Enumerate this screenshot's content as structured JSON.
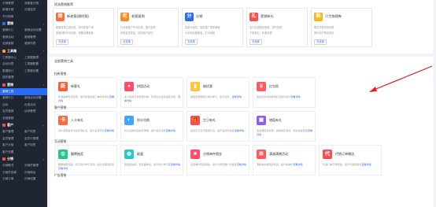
{
  "sidebar": {
    "groups": [
      {
        "id": "g0",
        "rows": [
          [
            "分销管理",
            "消费者分销"
          ],
          [
            "新增分销",
            "分销会员"
          ],
          [
            "开分销商",
            ""
          ]
        ]
      },
      {
        "id": "g1",
        "title": "营销",
        "rows": [
          [
            "营销中心",
            "营销活动设置"
          ],
          [
            "营销活动",
            "营销管理"
          ],
          [
            "全部营销",
            "营销列表"
          ]
        ]
      },
      {
        "id": "g2",
        "title": "工具箱",
        "rows": [
          [
            "工具箱中心",
            "工具箱管理"
          ],
          [
            "活动列表",
            "工具箱配置"
          ],
          [
            "数据统计",
            "工具箱设置"
          ],
          [
            "插件管理",
            ""
          ]
        ]
      },
      {
        "id": "g3",
        "title": "营销",
        "highlight": "营销工具",
        "rows": [
          [
            "营销中心",
            "营销活动设置"
          ],
          [
            "活动",
            "优惠活动"
          ],
          [
            "会员营销",
            "活动管理"
          ],
          [
            "全部营销",
            ""
          ]
        ]
      },
      {
        "id": "g4",
        "title": "客户",
        "rows": [
          [
            "客户管理",
            "客户列表"
          ],
          [
            "会员管理",
            "会员卡管理"
          ],
          [
            "客户分组",
            "客户标签"
          ],
          [
            "客户设置",
            ""
          ]
        ]
      },
      {
        "id": "g5",
        "title": "分销",
        "rows": [
          [
            "分销概况",
            "分销员管理"
          ],
          [
            "分销员招募",
            "分销商品"
          ],
          [
            "分销订单",
            "分销设置"
          ]
        ]
      }
    ]
  },
  "top_section": {
    "title": "优选营销推荐",
    "cards": [
      {
        "icon": "图",
        "color": "#ff6a3d",
        "name": "新老客(限时版)",
        "line1": "新客首单立减优惠，吸引新客下单",
        "line2": "老客回购专享优惠，唤醒沉睡老客",
        "btn": "去设置"
      },
      {
        "icon": "老",
        "color": "#ff8a1f",
        "name": "老客复购",
        "line1": "针对老客户专享优惠，提升复购",
        "line2": "享受会员权益，增加用户粘性",
        "btn": "去设置"
      },
      {
        "icon": "分",
        "color": "#2b6cf6",
        "name": "分销",
        "line1": "招募分销员，裂变推广带来新客",
        "line2": "分享商品赚佣金，扩大销量",
        "btn": "去设置"
      },
      {
        "icon": "礼",
        "color": "#ff4d4f",
        "name": "营销有礼",
        "line1": "支付后领取优惠券，提升复购",
        "line2": "下单有礼，刺激消费",
        "btn": "去设置"
      },
      {
        "icon": "购",
        "color": "#ffb31a",
        "name": "只生物理券",
        "line1": "购买享受折扣优惠",
        "line2": "提升用户购买转化",
        "btn": "去设置"
      }
    ]
  },
  "bottom_section": {
    "title": "全部营销工具",
    "categories": [
      {
        "name": "拉新营销",
        "tools": [
          {
            "icon": "新",
            "color": "#ff5c35",
            "name": "新客礼",
            "desc": "新客首单专享优惠，吸引新客快速下单转化成交",
            "link": "查看详情"
          },
          {
            "icon": "●",
            "color": "#ff4d6a",
            "name": "拼团活动",
            "desc": "多人拼团享受优惠价格，利用社交关系裂变拉新，",
            "link": "查看详情"
          },
          {
            "icon": "▮",
            "color": "#ffc53d",
            "name": "抽优惠",
            "desc": "抽取优惠券吸引用户参与，提升活跃，",
            "link": "查看详情"
          },
          {
            "icon": "￥",
            "color": "#ff5a5f",
            "name": "红包雨",
            "desc": "在指定时间内降落红包吸引用户",
            "link": "查看详情"
          }
        ]
      },
      {
        "name": "客户营销",
        "tools": [
          {
            "icon": "卡",
            "color": "#ff6a3d",
            "name": "入卡有礼",
            "desc": "用户领取会员卡后获得礼包，提升会员转化",
            "link": "查看详情"
          },
          {
            "icon": "◐",
            "color": "#3ea6ff",
            "name": "积分兑换",
            "desc": "积分兑换商品或优惠券，提升会员活跃",
            "link": "查看详情"
          },
          {
            "icon": "🎁",
            "color": "#ff4d4f",
            "name": "生日有礼",
            "desc": "会员生日当天赠送礼包，提升会员忠诚度",
            "link": "查看详情"
          },
          {
            "icon": "▣",
            "color": "#8b5cf6",
            "name": "储值有礼",
            "desc": "会员储值送优惠，提前锁定消费，增加资金回笼",
            "link": "查看详情"
          }
        ]
      },
      {
        "name": "互动营销",
        "tools": [
          {
            "icon": "◎",
            "color": "#22c58b",
            "name": "翻牌抽奖",
            "desc": "翻牌抽取奖品，吸引用户参与互动，提升店铺活跃度",
            "link": "查看详情"
          },
          {
            "icon": "◍",
            "color": "#2ec7c9",
            "name": "砸蛋",
            "desc": "砸金蛋抽奖，增加趣味性，提升用户参与度",
            "link": "查看详情"
          },
          {
            "icon": "★",
            "color": "#ff4d6a",
            "name": "分销单件佣金",
            "desc": "设置单件商品佣金，提升分销员推广积极性",
            "link": "查看详情"
          },
          {
            "icon": "⊞",
            "color": "#ff5a5f",
            "name": "满减满赠活动",
            "desc": "满额减免或赠送商品，提升客单价",
            "link": "查看详情"
          },
          {
            "icon": "代",
            "color": "#ff4d4f",
            "name": "代销订单赠送",
            "desc": "代销订单享受赠送，提升代销积极性",
            "link": "查看详情"
          }
        ]
      },
      {
        "name": "广告营销",
        "tools": []
      }
    ]
  }
}
